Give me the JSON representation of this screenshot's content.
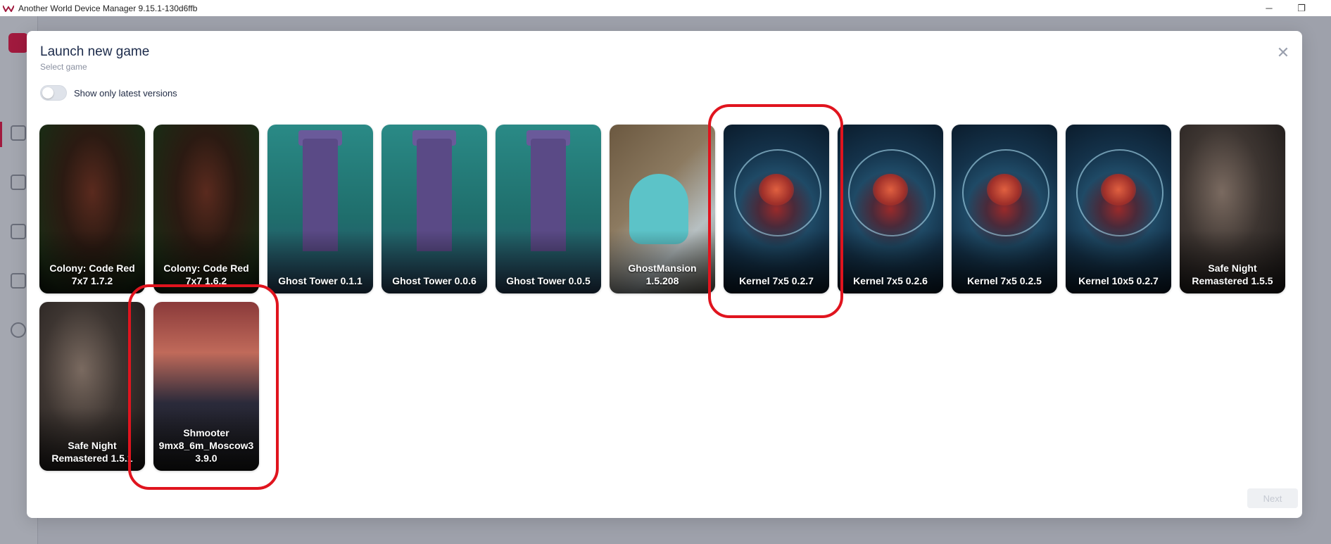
{
  "window": {
    "title": "Another World Device Manager 9.15.1-130d6ffb",
    "controls": {
      "minimize": "─",
      "restore": "❐"
    }
  },
  "modal": {
    "title": "Launch new game",
    "subtitle": "Select game",
    "close": "✕",
    "toggle": {
      "label": "Show only latest versions",
      "on": false
    },
    "next_label": "Next"
  },
  "games": [
    {
      "name": "Colony: Code Red 7x7 1.7.2",
      "art": "colony"
    },
    {
      "name": "Colony: Code Red 7x7 1.6.2",
      "art": "colony"
    },
    {
      "name": "Ghost Tower 0.1.1",
      "art": "tower"
    },
    {
      "name": "Ghost Tower 0.0.6",
      "art": "tower"
    },
    {
      "name": "Ghost Tower 0.0.5",
      "art": "tower"
    },
    {
      "name": "GhostMansion 1.5.208",
      "art": "ghost"
    },
    {
      "name": "Kernel 7x5 0.2.7",
      "art": "kernel",
      "highlighted": true
    },
    {
      "name": "Kernel 7x5 0.2.6",
      "art": "kernel"
    },
    {
      "name": "Kernel 7x5 0.2.5",
      "art": "kernel"
    },
    {
      "name": "Kernel 10x5 0.2.7",
      "art": "kernel"
    },
    {
      "name": "Safe Night Remastered 1.5.5",
      "art": "safe"
    },
    {
      "name": "Safe Night Remastered 1.5.1",
      "art": "safe"
    },
    {
      "name": "Shmooter 9mx8_6m_Moscow3 3.9.0",
      "art": "shmooter",
      "highlighted": true
    }
  ],
  "colors": {
    "accent": "#a11a3e",
    "annotation": "#e0141e"
  }
}
